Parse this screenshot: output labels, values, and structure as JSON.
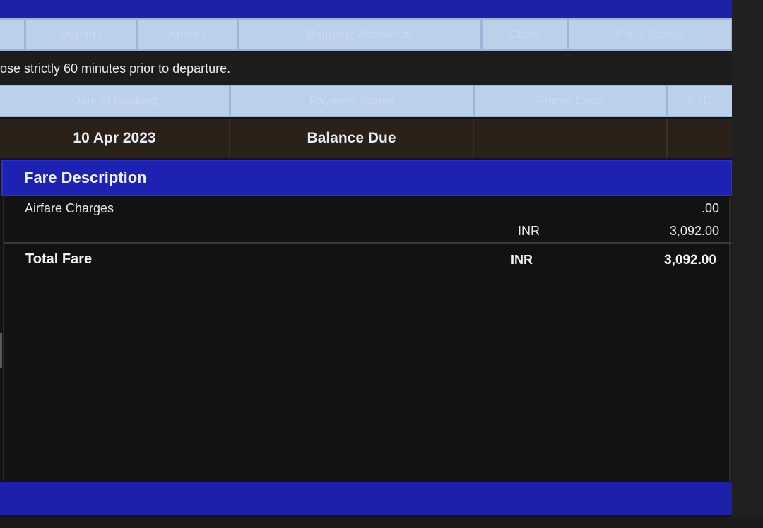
{
  "flight_table": {
    "headers": [
      "Departs",
      "Arrives",
      "Baggage Allowance",
      "Class",
      "Flight Status"
    ],
    "notice": "ose strictly 60 minutes prior to departure."
  },
  "booking_table": {
    "headers": [
      "Date of Booking",
      "Payment Status",
      "Promo Code",
      "PTC"
    ],
    "row": {
      "date_of_booking": "10 Apr 2023",
      "payment_status": "Balance Due",
      "promo_code": "",
      "ptc": ""
    }
  },
  "fare": {
    "title": "Fare Description",
    "airfare_label": "Airfare Charges",
    "airfare_amount": ".00",
    "airfare_currency": "INR",
    "airfare_subtotal": "3,092.00",
    "total_label": "Total Fare",
    "total_currency": "INR",
    "total_amount": "3,092.00"
  },
  "colors": {
    "brand_blue": "#1d20a8",
    "header_cell": "#bdd0ea",
    "booking_row": "#2b2118",
    "background": "#141414"
  }
}
